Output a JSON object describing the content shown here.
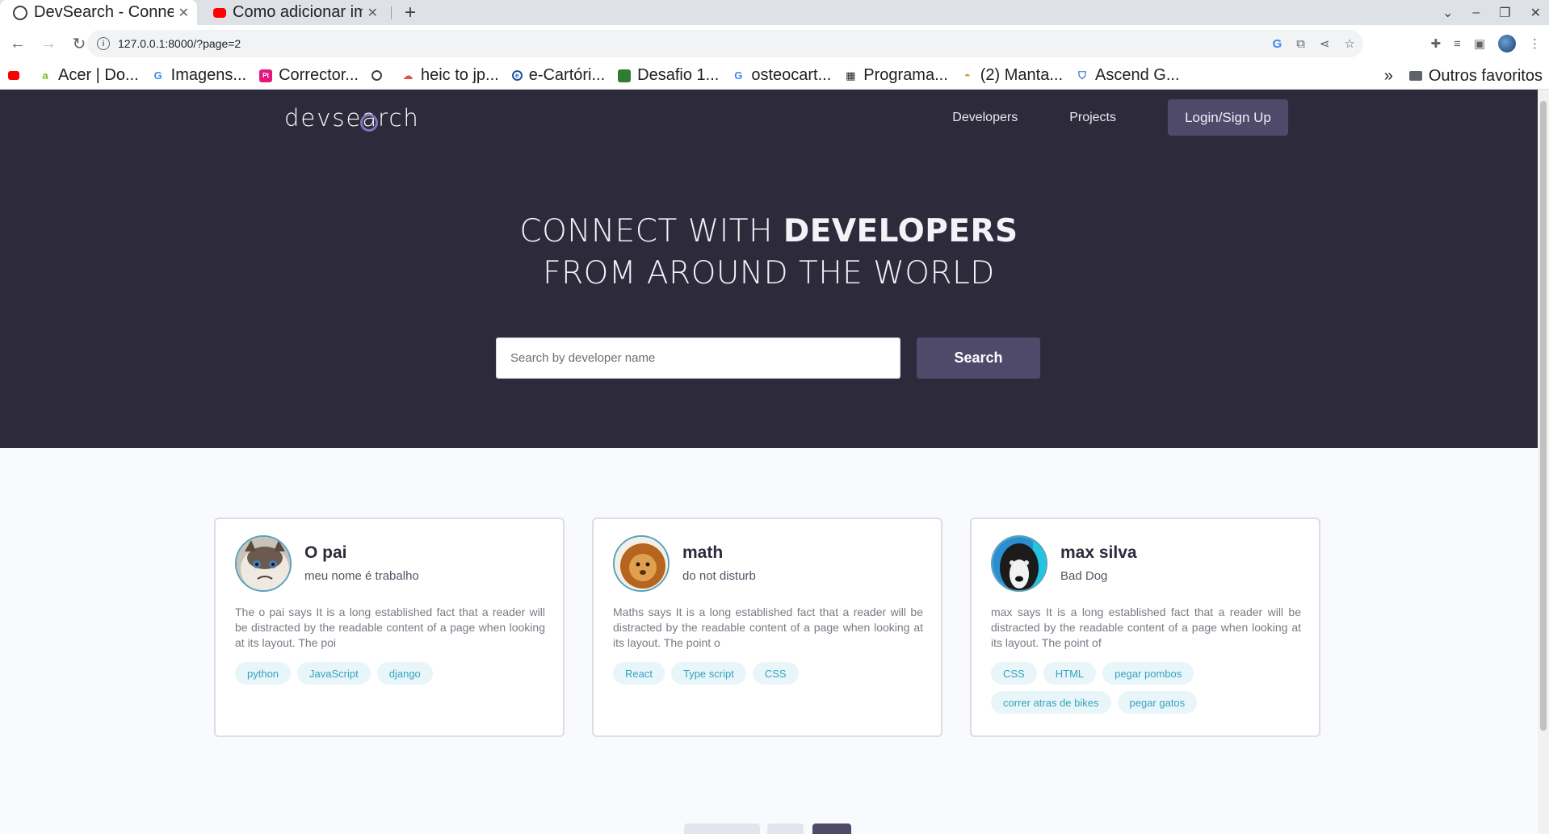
{
  "browser": {
    "tabs": [
      {
        "title": "DevSearch - Conne",
        "active": true
      },
      {
        "title": "Como adicionar im",
        "active": false
      }
    ],
    "new_tab": "+",
    "address": {
      "url": "127.0.0.1:8000/?page=2"
    },
    "bookmarks": [
      {
        "label": "Acer | Do...",
        "icon_color": "#83b81a"
      },
      {
        "label": "Imagens...",
        "icon_color": "#4285f4"
      },
      {
        "label": "Corrector...",
        "icon_color": "#e4177d"
      },
      {
        "label": "",
        "icon_color": "#3c4043"
      },
      {
        "label": "heic to jp...",
        "icon_color": "#d9534f"
      },
      {
        "label": "e-Cartóri...",
        "icon_color": "#1f4fa3"
      },
      {
        "label": "Desafio 1...",
        "icon_color": "#2e7d32"
      },
      {
        "label": "osteocart...",
        "icon_color": "#4285f4"
      },
      {
        "label": "Programa...",
        "icon_color": "#202124"
      },
      {
        "label": "(2) Manta...",
        "icon_color": "#c9a227"
      },
      {
        "label": "Ascend G...",
        "icon_color": "#3d6bc7"
      }
    ],
    "bookmarks_more": "»",
    "other_favorites": "Outros favoritos"
  },
  "site": {
    "logo": {
      "before": "devse",
      "mag": "a",
      "after": "rch"
    },
    "nav": {
      "developers": "Developers",
      "projects": "Projects",
      "login": "Login/Sign Up"
    },
    "hero": {
      "line1_light": "CONNECT WITH ",
      "line1_bold": "DEVELOPERS",
      "line2": "FROM AROUND THE WORLD"
    },
    "search": {
      "placeholder": "Search by developer name",
      "button": "Search"
    }
  },
  "profiles": [
    {
      "name": "O pai",
      "role": "meu nome é trabalho",
      "bio": "The o pai says It is a long established fact that a reader will be distracted by the readable content of a page when looking at its layout. The poi",
      "skills": [
        "python",
        "JavaScript",
        "django"
      ],
      "avatar": "grumpy-cat"
    },
    {
      "name": "math",
      "role": "do not disturb",
      "bio": "Maths says It is a long established fact that a reader will be distracted by the readable content of a page when looking at its layout. The point o",
      "skills": [
        "React",
        "Type script",
        "CSS"
      ],
      "avatar": "lion"
    },
    {
      "name": "max silva",
      "role": "Bad Dog",
      "bio": "max says It is a long established fact that a reader will be distracted by the readable content of a page when looking at its layout. The point of",
      "skills": [
        "CSS",
        "HTML",
        "pegar pombos",
        "correr atras de bikes",
        "pegar gatos"
      ],
      "avatar": "dog"
    }
  ],
  "colors": {
    "hero_bg": "#2d2b3b",
    "accent": "#4f4a6a",
    "chip_bg": "#e8f6fa",
    "chip_text": "#37a2bf"
  }
}
